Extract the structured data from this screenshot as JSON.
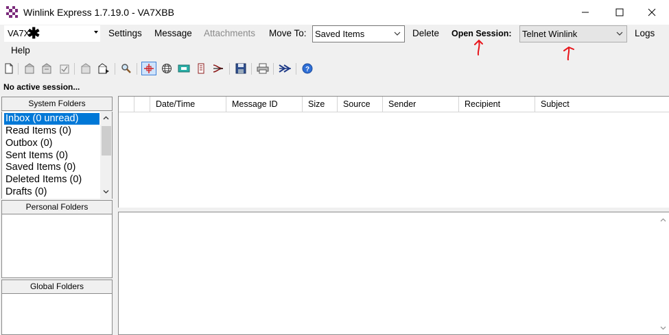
{
  "window": {
    "title": "Winlink Express 1.7.19.0 - VA7XBB",
    "minimize_label": "minimize",
    "maximize_label": "maximize",
    "close_label": "close"
  },
  "menubar": {
    "callsign_value": "VA7X",
    "settings": "Settings",
    "message": "Message",
    "attachments": "Attachments",
    "move_to": "Move To:",
    "move_to_value": "Saved Items",
    "delete": "Delete",
    "open_session": "Open Session:",
    "session_type_value": "Telnet Winlink",
    "logs": "Logs",
    "help": "Help"
  },
  "toolbar": {
    "icons": [
      "new-message-icon",
      "open-icon",
      "reply-icon",
      "reply-all-icon",
      "forward-icon",
      "print-preview-icon",
      "save-attachment-icon",
      "search-icon",
      "position-report-icon",
      "globe-icon",
      "contacts-icon",
      "templates-icon",
      "routing-icon",
      "save-icon",
      "print-icon",
      "forward-arrows-icon",
      "help-icon"
    ]
  },
  "status": {
    "text": "No active session..."
  },
  "folders": {
    "system_header": "System Folders",
    "personal_header": "Personal Folders",
    "global_header": "Global Folders",
    "system_items": [
      {
        "label": "Inbox  (0 unread)"
      },
      {
        "label": "Read Items  (0)"
      },
      {
        "label": "Outbox  (0)"
      },
      {
        "label": "Sent Items  (0)"
      },
      {
        "label": "Saved Items  (0)"
      },
      {
        "label": "Deleted Items  (0)"
      },
      {
        "label": "Drafts  (0)"
      }
    ]
  },
  "grid": {
    "columns": [
      "",
      "",
      "Date/Time",
      "Message ID",
      "Size",
      "Source",
      "Sender",
      "Recipient",
      "Subject"
    ],
    "rows": []
  },
  "annotations": {
    "arrow_color": "#e8141a"
  }
}
